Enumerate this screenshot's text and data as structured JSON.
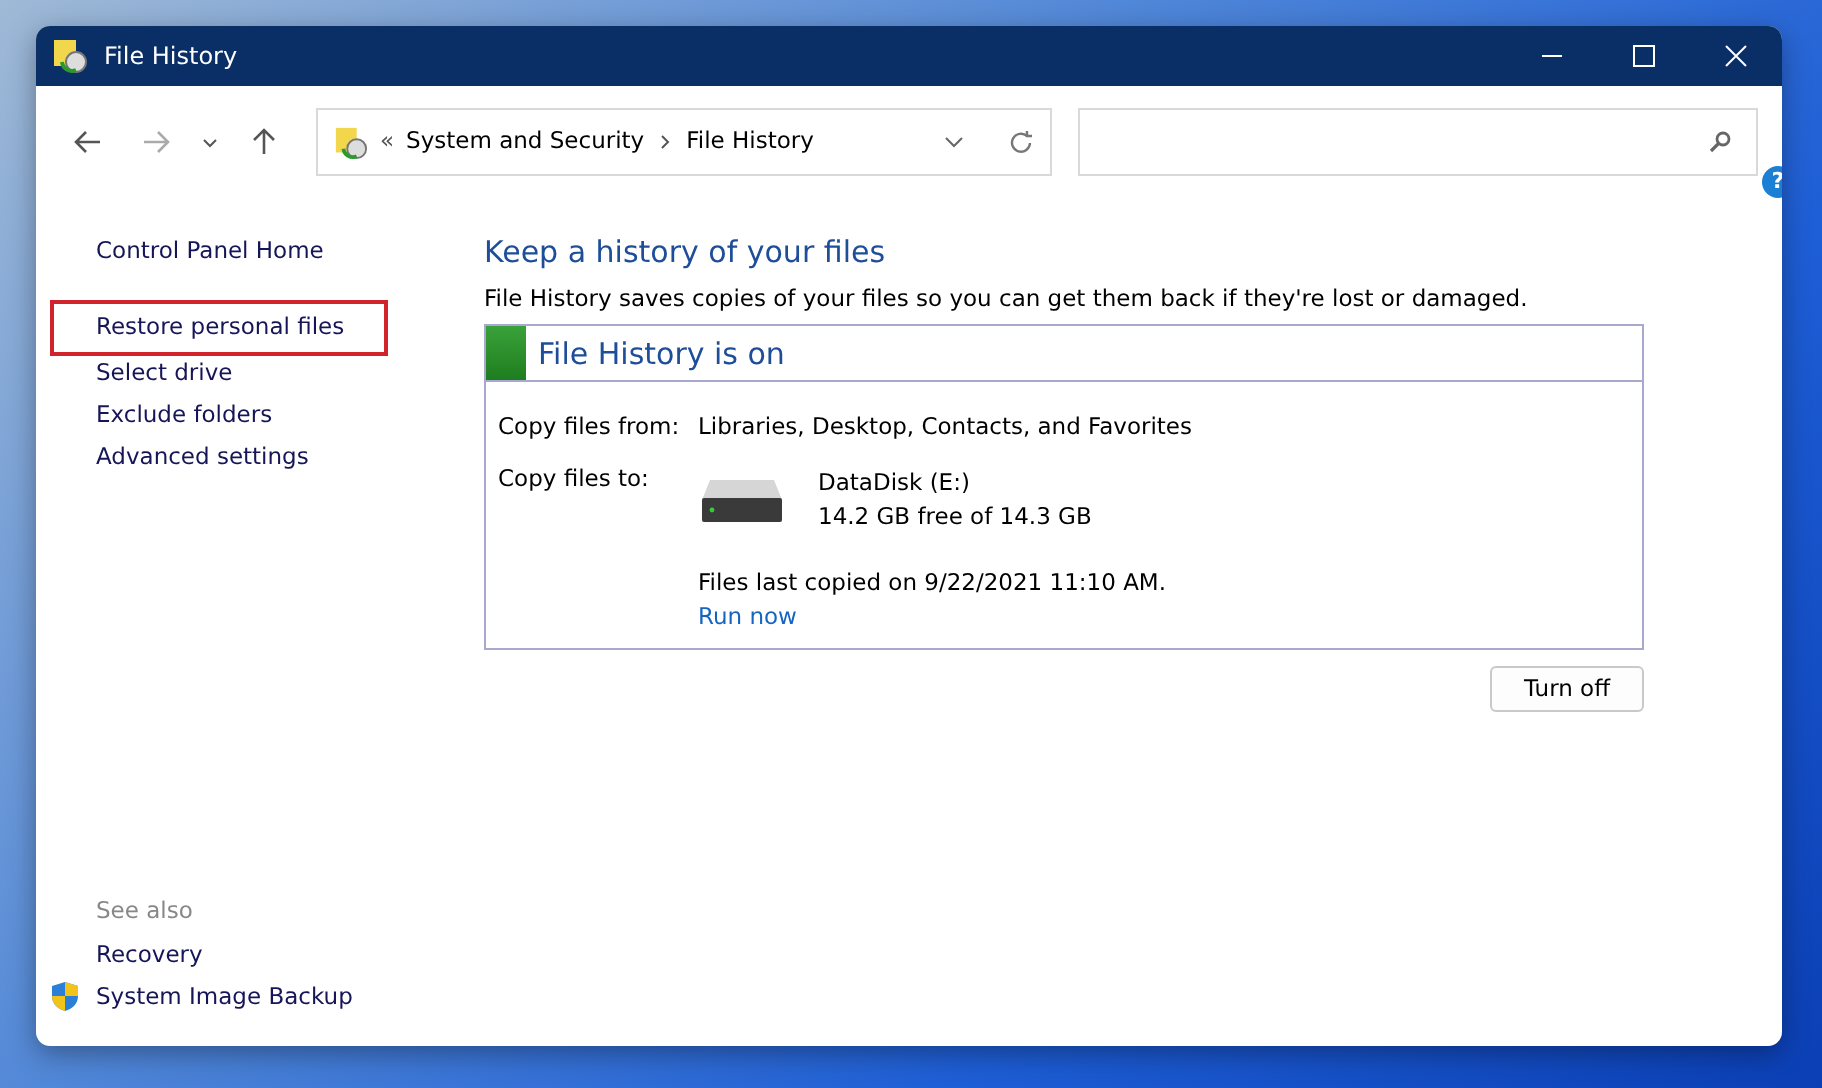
{
  "window": {
    "title": "File History"
  },
  "address_bar": {
    "overflow": "«",
    "crumbs": [
      "System and Security",
      "File History"
    ]
  },
  "nav": {
    "back_disabled": false,
    "forward_disabled": true
  },
  "help": "?",
  "sidebar": {
    "items": [
      {
        "label": "Control Panel Home",
        "highlighted": false
      },
      {
        "label": "Restore personal files",
        "highlighted": true
      },
      {
        "label": "Select drive",
        "highlighted": false
      },
      {
        "label": "Exclude folders",
        "highlighted": false
      },
      {
        "label": "Advanced settings",
        "highlighted": false
      }
    ],
    "see_also_title": "See also",
    "see_also": [
      {
        "label": "Recovery",
        "shield": false
      },
      {
        "label": "System Image Backup",
        "shield": true
      }
    ]
  },
  "main": {
    "heading": "Keep a history of your files",
    "description": "File History saves copies of your files so you can get them back if they're lost or damaged.",
    "status": {
      "title": "File History is on",
      "on": true,
      "copy_from_label": "Copy files from:",
      "copy_from": "Libraries, Desktop, Contacts, and Favorites",
      "copy_to_label": "Copy files to:",
      "drive_name": "DataDisk (E:)",
      "drive_space": "14.2 GB free of 14.3 GB",
      "last_copied": "Files last copied on 9/22/2021 11:10 AM.",
      "run_now": "Run now"
    },
    "turn_off": "Turn off"
  }
}
